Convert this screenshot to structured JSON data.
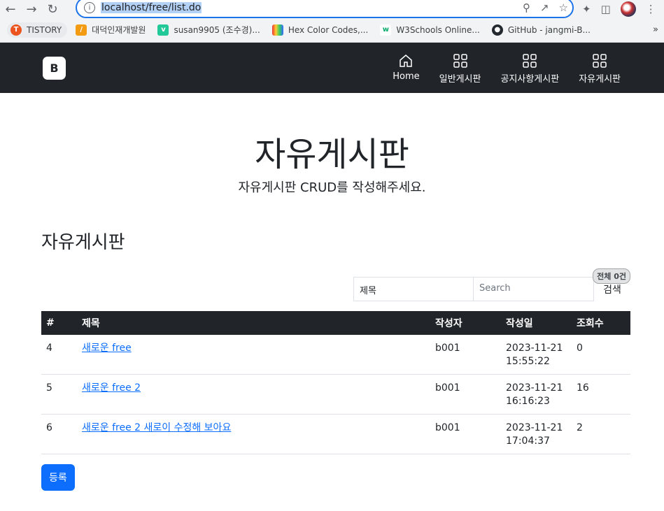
{
  "browser": {
    "url": "localhost/free/list.do",
    "bookmarks": [
      {
        "label": "TISTORY",
        "icon": "tistory-icon"
      },
      {
        "label": "대덕인재개발원",
        "icon": "ddit-icon"
      },
      {
        "label": "susan9905 (조수경)...",
        "icon": "velog-icon"
      },
      {
        "label": "Hex Color Codes,...",
        "icon": "hex-icon"
      },
      {
        "label": "W3Schools Online...",
        "icon": "w3schools-icon"
      },
      {
        "label": "GitHub - jangmi-B...",
        "icon": "github-icon"
      }
    ],
    "more": "»"
  },
  "navbar": {
    "brand": "B",
    "items": [
      {
        "label": "Home",
        "icon": "home-icon"
      },
      {
        "label": "일반게시판",
        "icon": "grid-icon"
      },
      {
        "label": "공지사항게시판",
        "icon": "grid-icon"
      },
      {
        "label": "자유게시판",
        "icon": "grid-icon"
      }
    ]
  },
  "hero": {
    "title": "자유게시판",
    "subtitle": "자유게시판 CRUD를 작성해주세요."
  },
  "board": {
    "heading": "자유게시판",
    "count": "전체 0건",
    "search": {
      "select_value": "제목",
      "placeholder": "Search",
      "button": "검색"
    },
    "columns": [
      "#",
      "제목",
      "작성자",
      "작성일",
      "조회수"
    ],
    "rows": [
      {
        "no": "4",
        "title": "새로운 free",
        "writer": "b001",
        "date": "2023-11-21",
        "time": "15:55:22",
        "hits": "0"
      },
      {
        "no": "5",
        "title": "새로운 free 2",
        "writer": "b001",
        "date": "2023-11-21",
        "time": "16:16:23",
        "hits": "16"
      },
      {
        "no": "6",
        "title": "새로운 free 2 새로이 수정해 보아요",
        "writer": "b001",
        "date": "2023-11-21",
        "time": "17:04:37",
        "hits": "2"
      }
    ],
    "register": "등록"
  },
  "colors": {
    "navbar_bg": "#212529",
    "primary": "#0d6efd"
  }
}
